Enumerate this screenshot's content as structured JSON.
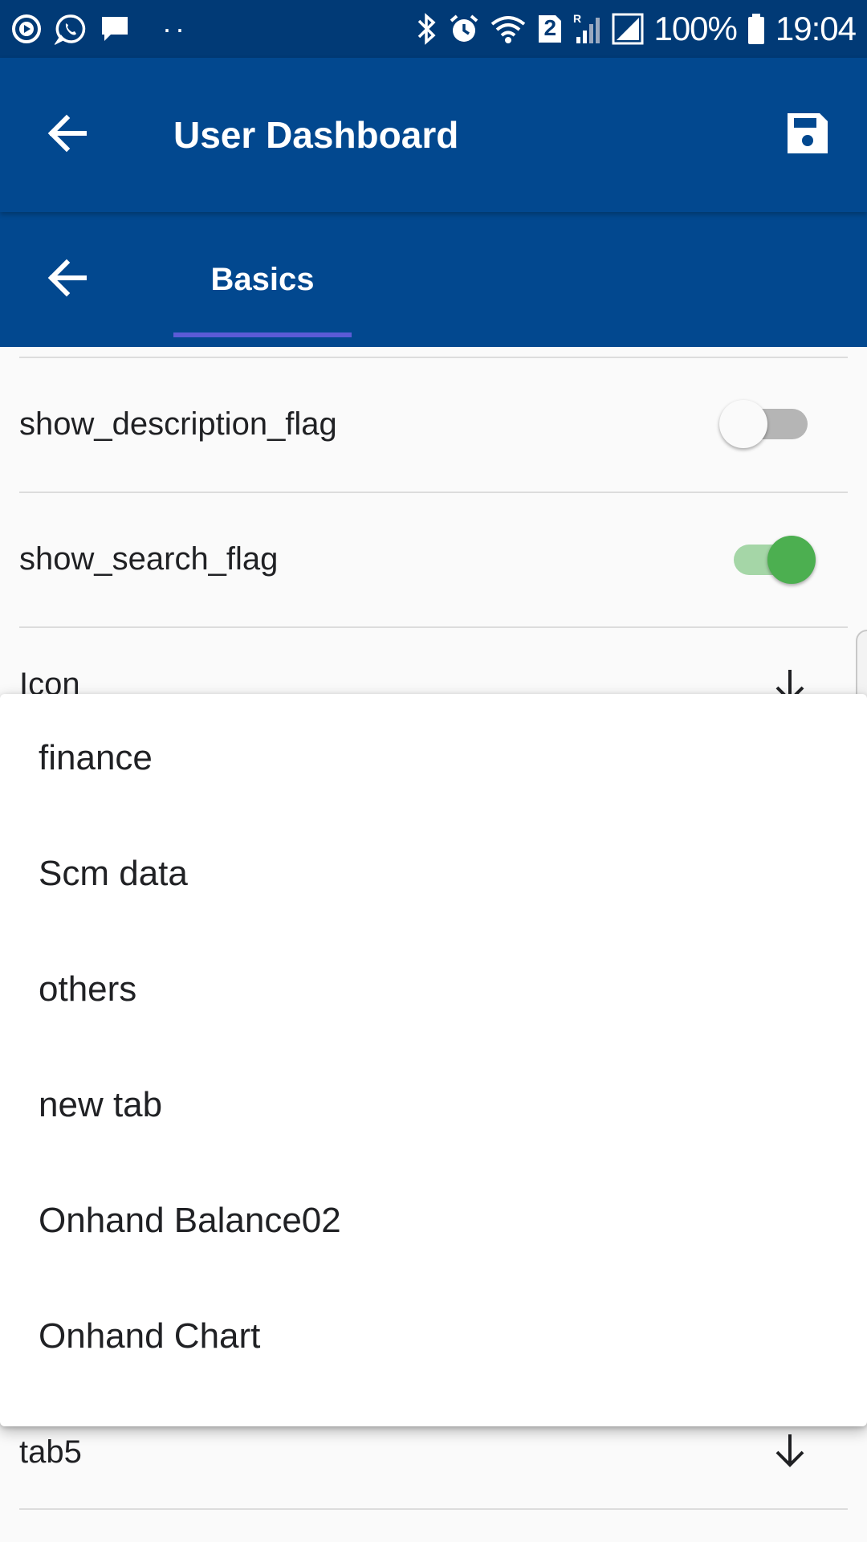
{
  "status_bar": {
    "battery_percent": "100%",
    "time": "19:04",
    "sim_badge": "2",
    "icons": [
      "play-circle-icon",
      "whatsapp-icon",
      "message-icon",
      "more-dots-icon",
      "bluetooth-icon",
      "alarm-icon",
      "wifi-icon",
      "sim-2-icon",
      "roaming-signal-icon",
      "signal-icon",
      "battery-icon"
    ]
  },
  "app_bar": {
    "title": "User Dashboard",
    "back_icon": "arrow-left-icon",
    "save_icon": "save-icon"
  },
  "tab_bar": {
    "back_icon": "arrow-left-icon",
    "active_tab": "Basics"
  },
  "settings": {
    "show_description_flag": {
      "label": "show_description_flag",
      "enabled": false
    },
    "show_search_flag": {
      "label": "show_search_flag",
      "enabled": true
    },
    "icon_field": {
      "label": "Icon"
    },
    "tab5_field": {
      "label": "tab5"
    }
  },
  "dropdown": {
    "options": [
      "finance",
      "Scm data",
      "others",
      "new tab",
      "Onhand Balance02",
      "Onhand Chart"
    ]
  },
  "colors": {
    "status_bar": "#013a76",
    "app_bar": "#02488f",
    "tab_indicator": "#5b5bd6",
    "switch_on": "#4caf50",
    "switch_on_track": "#a5d6a7",
    "switch_off_track": "#b5b5b5"
  }
}
